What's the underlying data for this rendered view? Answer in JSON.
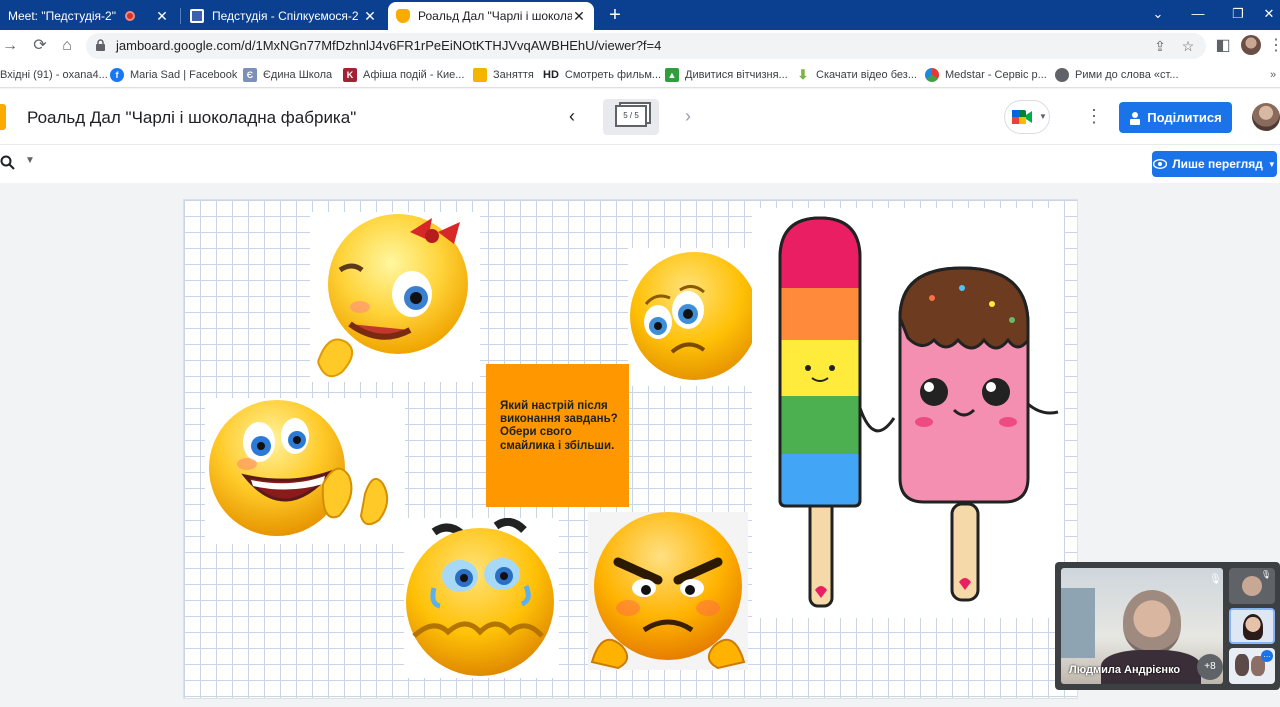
{
  "tabs": [
    {
      "title": "Meet: \"Педстудія-2\"",
      "recording": true
    },
    {
      "title": "Педстудія - Спілкуємося-2"
    },
    {
      "title": "Роальд Дал \"Чарлі і шоколадна",
      "active": true
    }
  ],
  "window_controls": [
    "⌄",
    "—",
    "❐",
    "✕"
  ],
  "address": {
    "url": "jamboard.google.com/d/1MxNGn77MfDzhnlJ4v6FR1rPeEiNOtKTHJVvqAWBHEhU/viewer?f=4"
  },
  "bookmarks": [
    {
      "label": "Вхідні (91) - oxana4...",
      "icon": "gmail-icon"
    },
    {
      "label": "Maria Sad | Facebook",
      "icon": "facebook-icon"
    },
    {
      "label": "Єдина Школа",
      "icon": "school-icon"
    },
    {
      "label": "Афіша подій - Кие...",
      "icon": "events-icon"
    },
    {
      "label": "Заняття",
      "icon": "classroom-icon"
    },
    {
      "label": "Смотреть фильм...",
      "icon": "hd-icon",
      "prefix": "HD"
    },
    {
      "label": "Дивитися вітчизня...",
      "icon": "tv-icon"
    },
    {
      "label": "Скачати відео без...",
      "icon": "download-icon"
    },
    {
      "label": "Medstar - Сервіс р...",
      "icon": "medstar-icon"
    },
    {
      "label": "Рими до слова «ст...",
      "icon": "globe-icon"
    }
  ],
  "jam": {
    "title": "Роальд Дал \"Чарлі і шоколадна фабрика\"",
    "frame_indicator": "5 / 5",
    "share_label": "Поділитися",
    "view_only_label": "Лише перегляд"
  },
  "note": {
    "text": "Який настрій після виконання завдань? Обери свого смайлика і збільши.",
    "color": "#ff9800"
  },
  "stickers": [
    "winking-girl-emoji",
    "sad-pleading-emoji",
    "laughing-waving-emoji",
    "crying-biting-lip-emoji",
    "angry-emoji",
    "popsicle-couple"
  ],
  "meet": {
    "presenter_name": "Людмила Андрієнко",
    "extra_count": "+8"
  },
  "colors": {
    "chrome_tabs": "#0b3f8f",
    "primary_blue": "#1a73e8"
  }
}
